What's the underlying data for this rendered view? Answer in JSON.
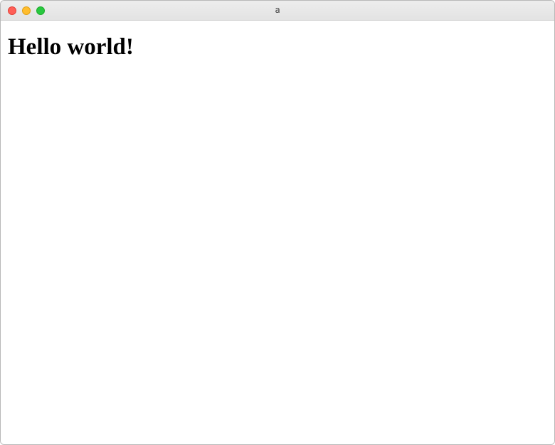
{
  "window": {
    "title": "a"
  },
  "content": {
    "heading": "Hello world!"
  }
}
